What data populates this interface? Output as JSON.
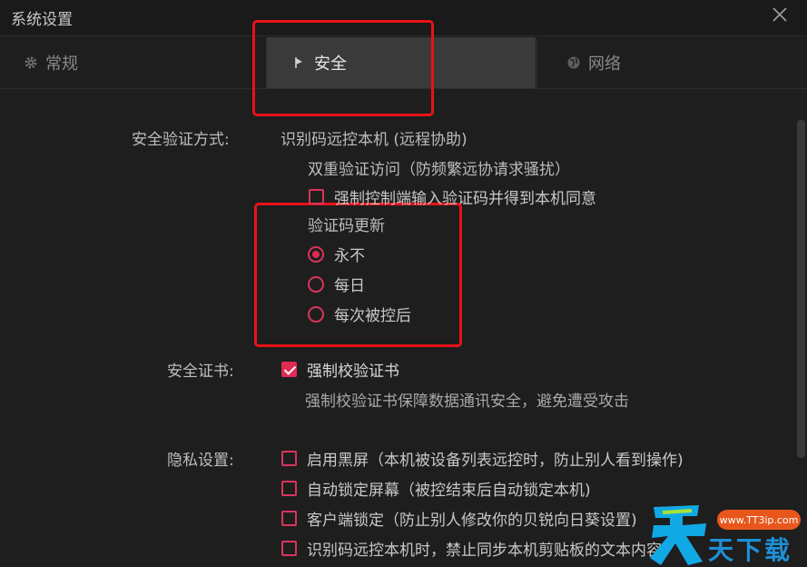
{
  "window": {
    "title": "系统设置"
  },
  "tabs": [
    {
      "label": "常规",
      "icon": "gear-icon"
    },
    {
      "label": "安全",
      "icon": "flag-icon",
      "active": true
    },
    {
      "label": "网络",
      "icon": "globe-icon"
    }
  ],
  "security": {
    "verify_method": {
      "label": "安全验证方式:",
      "mode": "识别码远控本机 (远程协助)",
      "double_verify": "双重验证访问（防频繁远协请求骚扰）",
      "force_code_option": {
        "label": "强制控制端输入验证码并得到本机同意",
        "checked": false
      },
      "code_update_heading": "验证码更新",
      "code_update_options": [
        {
          "label": "永不",
          "selected": true
        },
        {
          "label": "每日",
          "selected": false
        },
        {
          "label": "每次被控后",
          "selected": false
        }
      ]
    },
    "certificate": {
      "label": "安全证书:",
      "option": {
        "label": "强制校验证书",
        "checked": true
      },
      "description": "强制校验证书保障数据通讯安全，避免遭受攻击"
    },
    "privacy": {
      "label": "隐私设置:",
      "options": [
        {
          "label": "启用黑屏（本机被设备列表远控时，防止别人看到操作)",
          "checked": false
        },
        {
          "label": "自动锁定屏幕（被控结束后自动锁定本机)",
          "checked": false
        },
        {
          "label": "客户端锁定（防止别人修改你的贝锐向日葵设置)",
          "checked": false
        },
        {
          "label": "识别码远控本机时，禁止同步本机剪贴板的文本内容",
          "checked": false
        }
      ]
    }
  },
  "watermark": {
    "url": "www.TT3ip.com",
    "brand": "天下载"
  },
  "colors": {
    "accent": "#e02b55",
    "highlight": "#e8121a",
    "background": "#1e1e1e",
    "active_tab": "#3a3a3a"
  }
}
